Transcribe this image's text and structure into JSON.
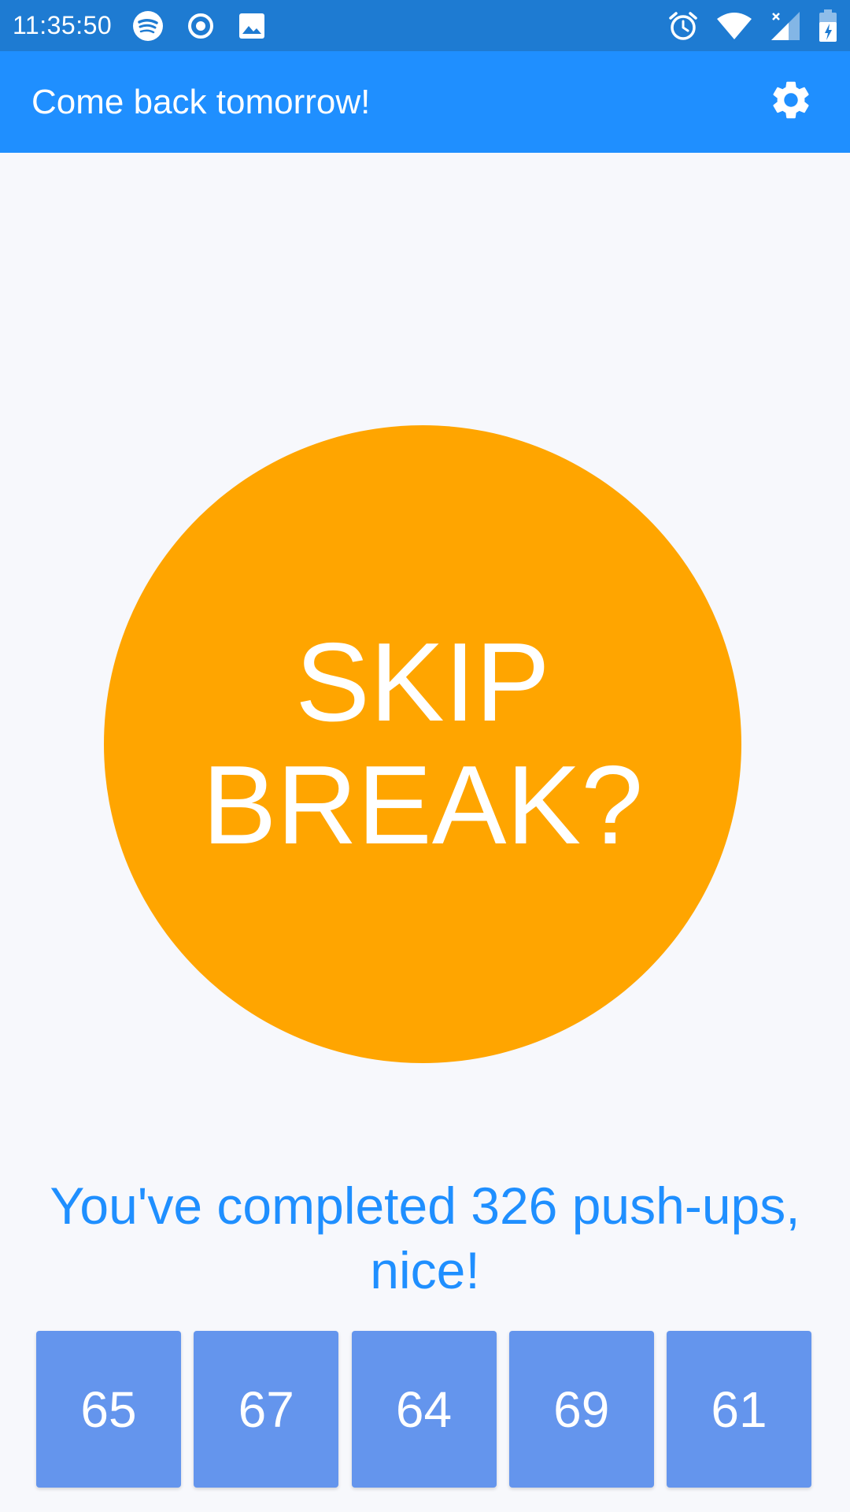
{
  "status_bar": {
    "time": "11:35:50",
    "left_icons": [
      "spotify-icon",
      "record-icon",
      "image-icon"
    ],
    "right_icons": [
      "alarm-icon",
      "wifi-icon",
      "cell-signal-icon",
      "battery-icon"
    ]
  },
  "app_bar": {
    "title": "Come back tomorrow!",
    "settings_icon": "gear-icon"
  },
  "main": {
    "skip_line1": "SKIP",
    "skip_line2": "BREAK?",
    "completed_line1": "You've completed 326 push-ups,",
    "completed_line2": "nice!"
  },
  "reps": [
    {
      "label": "65"
    },
    {
      "label": "67"
    },
    {
      "label": "64"
    },
    {
      "label": "69"
    },
    {
      "label": "61"
    }
  ],
  "colors": {
    "status_bar": "#1E7BD2",
    "app_bar": "#1F8FFF",
    "circle": "#FFA500",
    "rep_box": "#6495ED",
    "accent_text": "#1F8FFF",
    "background": "#F7F8FC"
  }
}
